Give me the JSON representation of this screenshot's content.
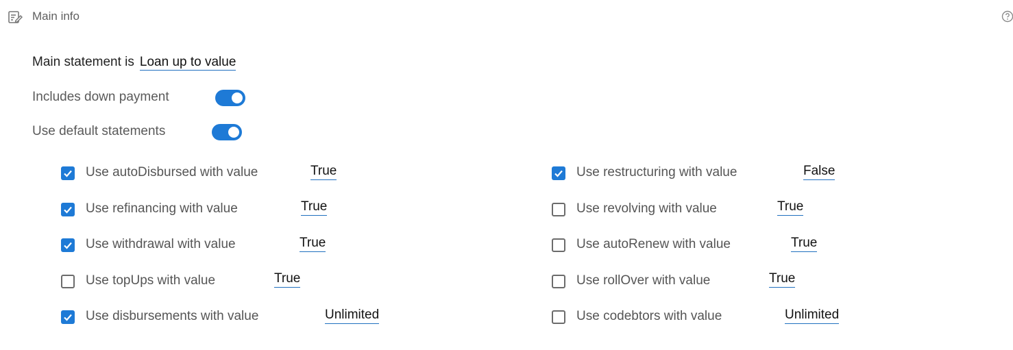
{
  "header": {
    "title": "Main info",
    "icon": "edit-note-icon",
    "help_icon": "help-circle-icon"
  },
  "main_statement": {
    "label": "Main statement is",
    "value": "Loan up to value"
  },
  "toggles": [
    {
      "label": "Includes down payment",
      "on": true
    },
    {
      "label": "Use default statements",
      "on": true
    }
  ],
  "options_left": [
    {
      "label": "Use autoDisbursed with value",
      "checked": true,
      "value": "True"
    },
    {
      "label": "Use refinancing with value",
      "checked": true,
      "value": "True"
    },
    {
      "label": "Use withdrawal with value",
      "checked": true,
      "value": "True"
    },
    {
      "label": "Use topUps with value",
      "checked": false,
      "value": "True"
    },
    {
      "label": "Use disbursements with value",
      "checked": true,
      "value": "Unlimited"
    }
  ],
  "options_right": [
    {
      "label": "Use restructuring with value",
      "checked": true,
      "value": "False"
    },
    {
      "label": "Use revolving with value",
      "checked": false,
      "value": "True"
    },
    {
      "label": "Use autoRenew with value",
      "checked": false,
      "value": "True"
    },
    {
      "label": "Use rollOver with value",
      "checked": false,
      "value": "True"
    },
    {
      "label": "Use codebtors with value",
      "checked": false,
      "value": "Unlimited"
    }
  ],
  "colors": {
    "accent": "#1e7ad6",
    "text": "#555555",
    "link_underline": "#1f6fbf"
  }
}
